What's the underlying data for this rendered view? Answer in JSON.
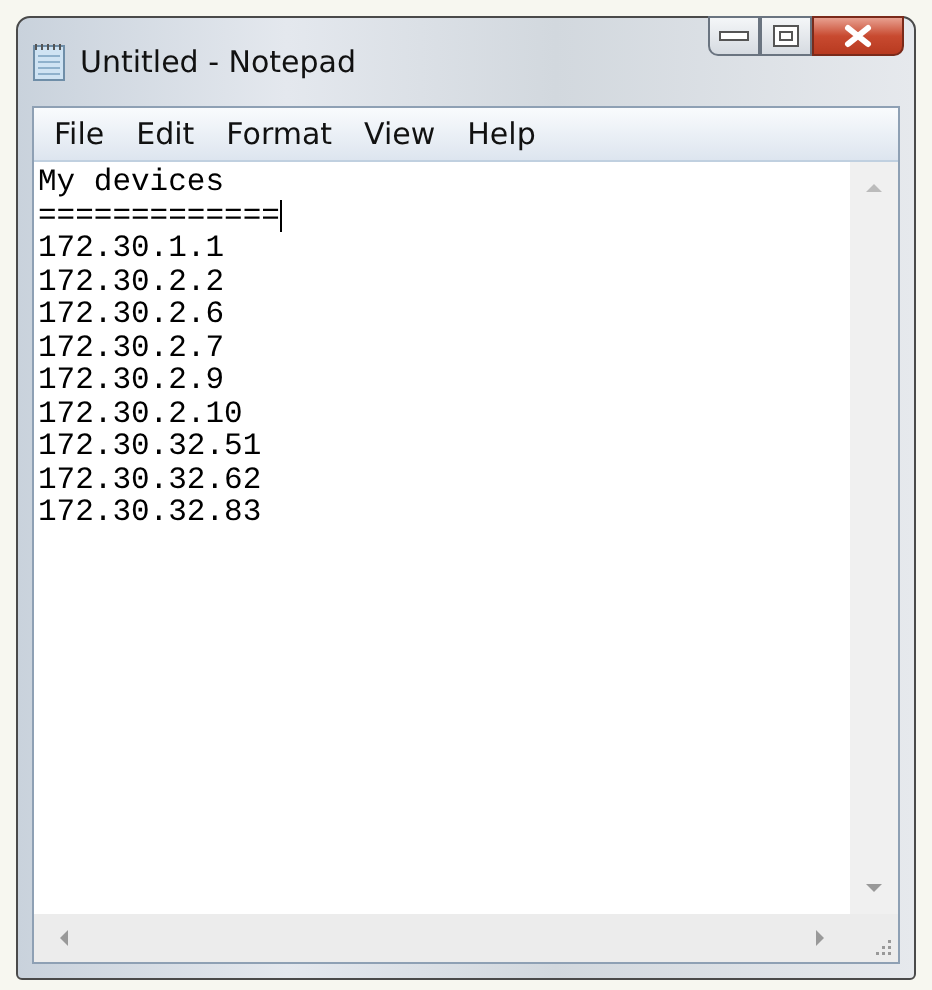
{
  "window": {
    "title": "Untitled - Notepad"
  },
  "menu": [
    "File",
    "Edit",
    "Format",
    "View",
    "Help"
  ],
  "editor": {
    "lines": [
      "My devices",
      "=============",
      "172.30.1.1",
      "172.30.2.2",
      "172.30.2.6",
      "172.30.2.7",
      "172.30.2.9",
      "172.30.2.10",
      "172.30.32.51",
      "172.30.32.62",
      "172.30.32.83"
    ]
  }
}
